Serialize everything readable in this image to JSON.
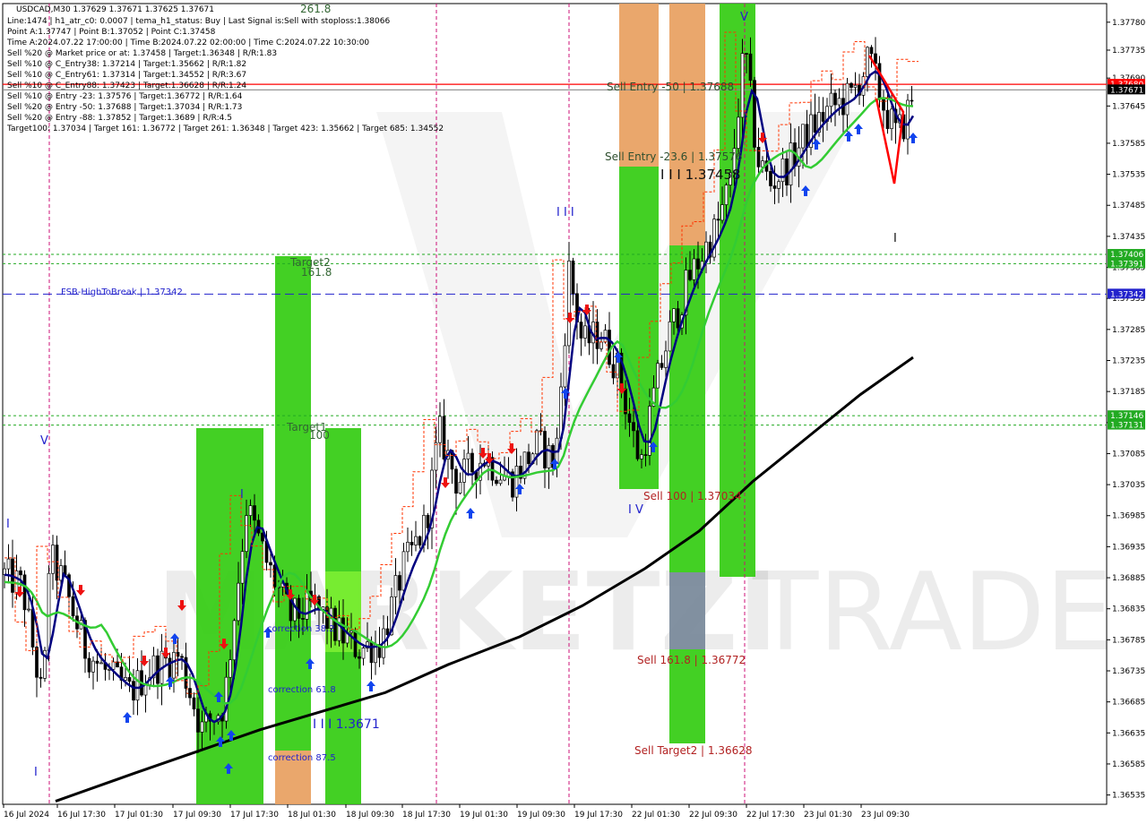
{
  "chart_data": {
    "type": "candlestick",
    "symbol_line": "USDCAD,M30  1.37629 1.37671 1.37625 1.37671",
    "info_lines": [
      "Line:1474  |  h1_atr_c0: 0.0007  |  tema_h1_status: Buy  |  Last Signal is:Sell with stoploss:1.38066",
      "Point A:1.37747  |  Point B:1.37052  |  Point C:1.37458",
      "Time A:2024.07.22 17:00:00  |  Time B:2024.07.22 02:00:00  |  Time C:2024.07.22 10:30:00",
      "Sell %20 @ Market price or at: 1.37458  |  Target:1.36348  |  R/R:1.83",
      "Sell %10 @ C_Entry38: 1.37214  |  Target:1.35662  |  R/R:1.82",
      "Sell %10 @ C_Entry61: 1.37314  |  Target:1.34552  |  R/R:3.67",
      "Sell %10 @ C_Entry88: 1.37423  |  Target:1.36628  |  R/R:1.24",
      "Sell %10 @ Entry -23: 1.37576  |  Target:1.36772  |  R/R:1.64",
      "Sell %20 @ Entry -50: 1.37688  |  Target:1.37034  |  R/R:1.73",
      "Sell %20 @ Entry -88: 1.37852  |  Target:1.3689  |  R/R:4.5",
      "Target100: 1.37034  |  Target 161: 1.36772  |  Target 261: 1.36348  |  Target 423: 1.35662  |  Target 685: 1.34552"
    ],
    "y_ticks": [
      "1.37780",
      "1.37735",
      "1.37690",
      "1.37645",
      "1.37585",
      "1.37535",
      "1.37485",
      "1.37435",
      "1.37385",
      "1.37335",
      "1.37285",
      "1.37235",
      "1.37185",
      "1.37135",
      "1.37085",
      "1.37035",
      "1.36985",
      "1.36935",
      "1.36885",
      "1.36835",
      "1.36785",
      "1.36735",
      "1.36685",
      "1.36635",
      "1.36585",
      "1.36535"
    ],
    "x_ticks": [
      "16 Jul 2024",
      "16 Jul 17:30",
      "17 Jul 01:30",
      "17 Jul 09:30",
      "17 Jul 17:30",
      "18 Jul 01:30",
      "18 Jul 09:30",
      "18 Jul 17:30",
      "19 Jul 01:30",
      "19 Jul 09:30",
      "19 Jul 17:30",
      "22 Jul 01:30",
      "22 Jul 09:30",
      "22 Jul 17:30",
      "23 Jul 01:30",
      "23 Jul 09:30"
    ],
    "ylim": [
      1.3652,
      1.3781
    ],
    "price_tags": [
      {
        "text": "1.37680",
        "color": "#ff0000"
      },
      {
        "text": "1.37671",
        "color": "#000000"
      },
      {
        "text": "1.37406",
        "color": "#22aa22"
      },
      {
        "text": "1.37391",
        "color": "#22aa22"
      },
      {
        "text": "1.37342",
        "color": "#2222cc"
      },
      {
        "text": "1.37146",
        "color": "#22aa22"
      },
      {
        "text": "1.37131",
        "color": "#22aa22"
      }
    ],
    "levels": [
      {
        "value": 1.3768,
        "color": "#ff0000",
        "style": "solid"
      },
      {
        "value": 1.37671,
        "color": "#888888",
        "style": "solid"
      },
      {
        "value": 1.37406,
        "color": "#22aa22",
        "style": "dashed"
      },
      {
        "value": 1.37391,
        "color": "#22aa22",
        "style": "dashed"
      },
      {
        "value": 1.37342,
        "color": "#2222cc",
        "style": "dashed"
      },
      {
        "value": 1.37146,
        "color": "#22aa22",
        "style": "dashed"
      },
      {
        "value": 1.37131,
        "color": "#22aa22",
        "style": "dashed"
      }
    ],
    "zone_labels": {
      "target2": "Target2",
      "target2_pct": "161.8",
      "target1": "Target1",
      "target1_pct": "100",
      "top_pct": "261.8",
      "fsb": "FSB-HighToBreak  |  1.37342",
      "sell_entry_50": "Sell Entry -50 | 1.37688",
      "sell_entry_23": "Sell Entry -23.6 | 1.37576",
      "point_c": "I I I 1.37458",
      "sell_100": "Sell 100 | 1.37034",
      "sell_161": "Sell 161.8 | 1.36772",
      "sell_target2": "Sell Target2 | 1.36628",
      "correction_38": "correction 38.2",
      "correction_61": "correction 61.8",
      "correction_87": "correction 87.5",
      "level_36671": "I I I 1.3671",
      "wave_v1": "V",
      "wave_v2": "V",
      "wave_i1": "I",
      "wave_i2": "I",
      "wave_iii": "I I I",
      "wave_iv": "I V",
      "wave_i3": "I",
      "wave_i4": "I"
    },
    "watermark": "MARKETZI TRADE",
    "colors": {
      "green_zone": "#33cc11",
      "orange_zone": "#e8a060",
      "gray_zone": "#778899",
      "ma_blue": "#000080",
      "ma_green": "#33cc33",
      "ma_black": "#000000",
      "envelope_red": "#ff3300"
    }
  }
}
